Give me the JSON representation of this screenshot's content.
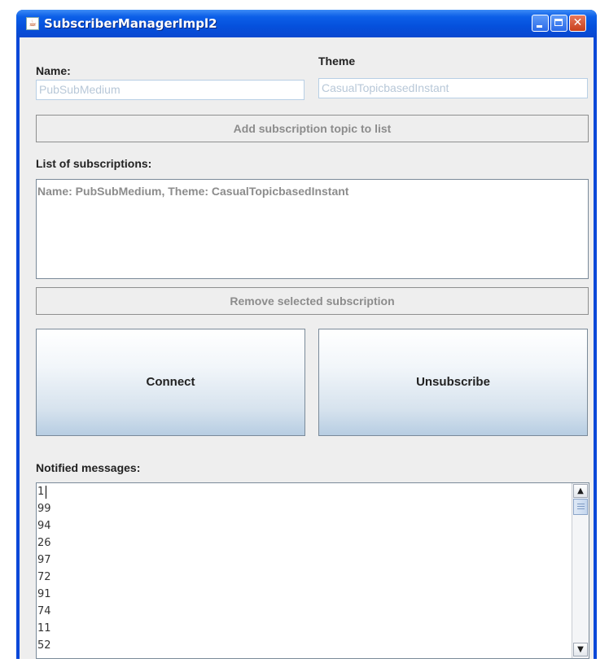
{
  "window": {
    "title": "SubscriberManagerImpl2",
    "app_icon": "java-coffee-cup-icon"
  },
  "form": {
    "name_label": "Name:",
    "name_value": "PubSubMedium",
    "theme_label": "Theme",
    "theme_value": "CasualTopicbasedInstant",
    "add_button": "Add subscription topic to list",
    "subscriptions_label": "List of subscriptions:",
    "subscriptions": [
      "Name: PubSubMedium, Theme: CasualTopicbasedInstant"
    ],
    "remove_button": "Remove selected subscription",
    "connect_button": "Connect",
    "unsubscribe_button": "Unsubscribe",
    "messages_label": "Notified messages:",
    "messages": [
      "1",
      "99",
      "94",
      "26",
      "97",
      "72",
      "91",
      "74",
      "11",
      "52"
    ]
  },
  "colors": {
    "titlebar": "#0550dc",
    "client_bg": "#eeeeee",
    "disabled_text": "#8c8c8c"
  }
}
